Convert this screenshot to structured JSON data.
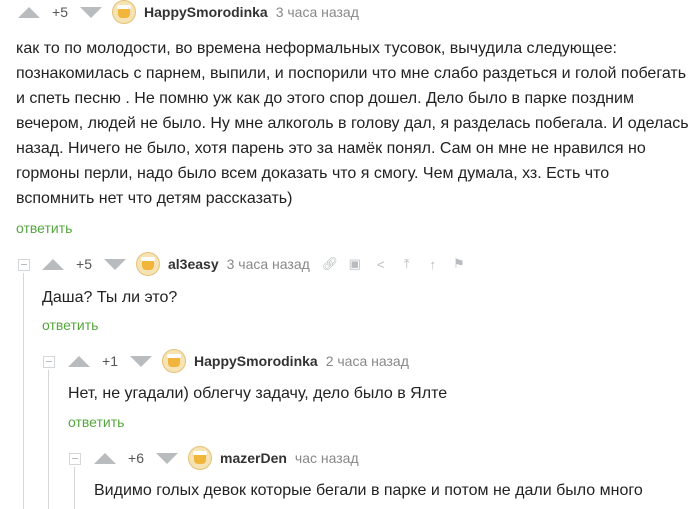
{
  "comments": [
    {
      "rating": "+5",
      "username": "HappySmorodinka",
      "time": "3 часа назад",
      "text": "как то по молодости, во времена неформальных тусовок, вычудила следующее: познакомилась с парнем, выпили, и поспорили что мне слабо раздеться и голой побегать и спеть песню . Не помню уж как до этого спор дошел. Дело было в парке поздним вечером, людей не было. Ну мне алкоголь в голову дал, я разделась  побегала. И оделась назад. Ничего не было, хотя парень это за намёк понял. Сам он мне не нравился  но гормоны перли, надо было всем доказать что я смогу. Чем думала, хз. Есть что вспомнить  нет что детям рассказать)",
      "reply": "ответить"
    },
    {
      "rating": "+5",
      "username": "al3easy",
      "time": "3 часа назад",
      "text": "Даша? Ты ли это?",
      "reply": "ответить"
    },
    {
      "rating": "+1",
      "username": "HappySmorodinka",
      "time": "2 часа назад",
      "text": "Нет, не угадали) облегчу задачу, дело было в Ялте",
      "reply": "ответить"
    },
    {
      "rating": "+6",
      "username": "mazerDen",
      "time": "час назад",
      "text": "Видимо голых девок которые бегали в парке и потом не дали было много"
    }
  ],
  "icons": {
    "vote_up": "triangle-up-icon",
    "vote_down": "triangle-down-icon",
    "link": "link-icon",
    "save": "save-icon",
    "share": "share-icon",
    "up_to_parent": "arrow-up-icon",
    "branch": "branch-icon",
    "report": "flag-icon"
  },
  "colors": {
    "reply_link": "#56a63f",
    "vote_arrow": "#b8bcbf",
    "time": "#888888"
  }
}
